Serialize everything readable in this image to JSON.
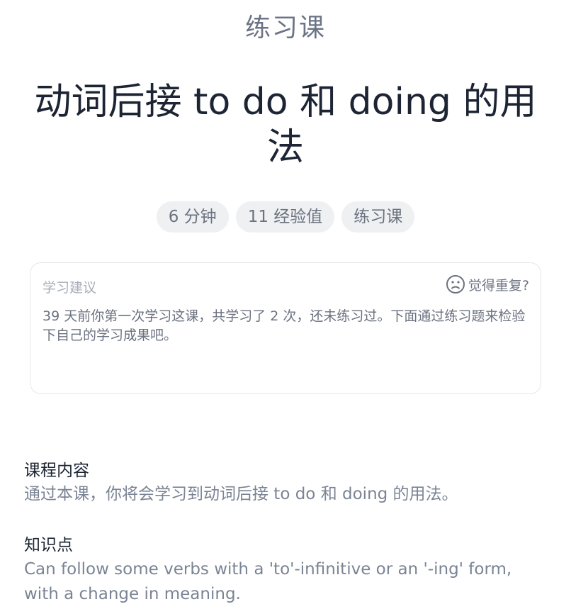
{
  "header": {
    "lesson_type": "练习课",
    "title": "动词后接 to do 和 doing 的用法"
  },
  "tags": [
    "6 分钟",
    "11 经验值",
    "练习课"
  ],
  "advice": {
    "title": "学习建议",
    "repeat_label": "觉得重复?",
    "repeat_icon": "sad-face-icon",
    "text": "39 天前你第一次学习这课，共学习了 2 次，还未练习过。下面通过练习题来检验下自己的学习成果吧。"
  },
  "course": {
    "label": "课程内容",
    "text": "通过本课，你将会学习到动词后接 to do 和 doing 的用法。"
  },
  "knowledge": {
    "label": "知识点",
    "text": "Can follow some verbs with a 'to'-infinitive or an '-ing' form, with a change in meaning."
  }
}
